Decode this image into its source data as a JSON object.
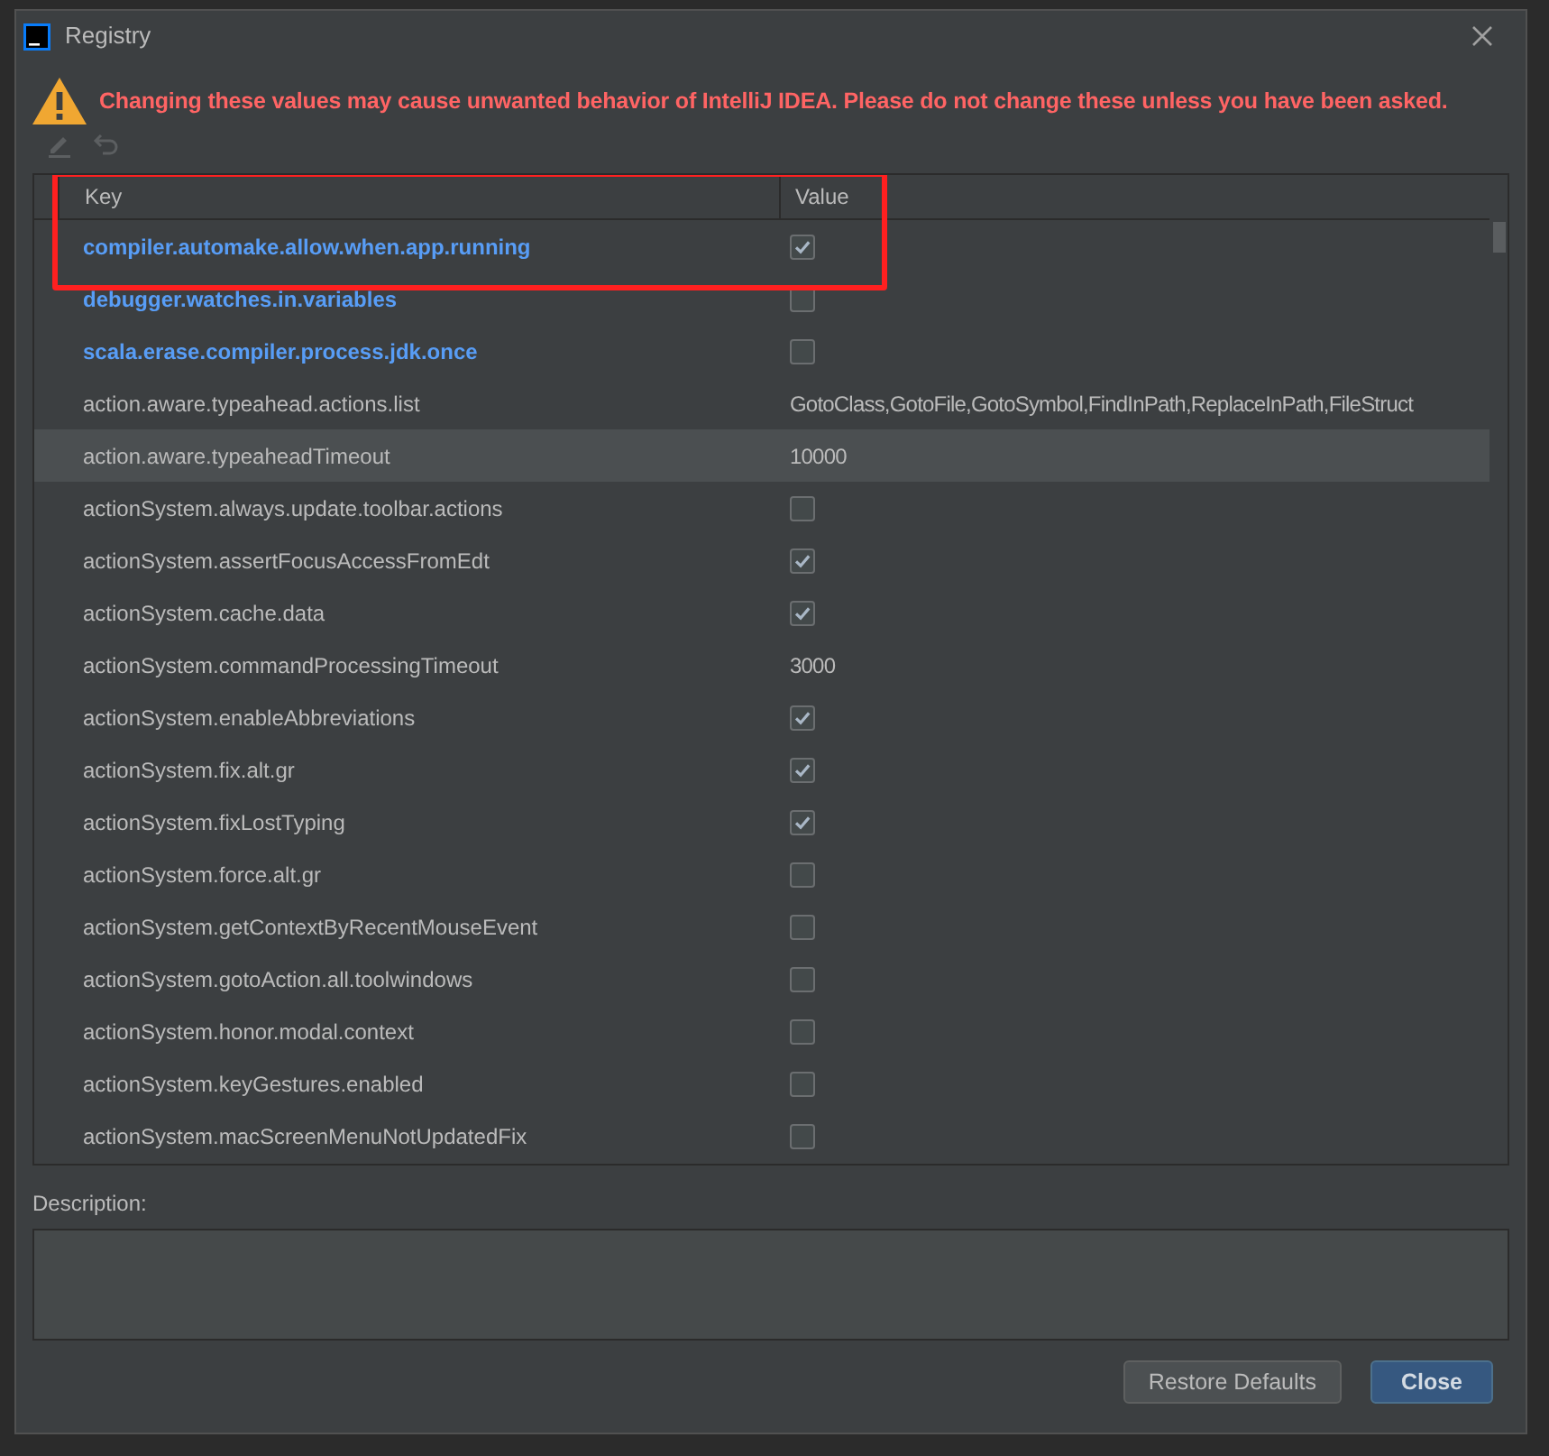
{
  "window": {
    "title": "Registry"
  },
  "warning": "Changing these values may cause unwanted behavior of IntelliJ IDEA. Please do not change these unless you have been asked.",
  "toolbar": [
    {
      "kind": "edit",
      "disabled": true
    },
    {
      "kind": "undo",
      "disabled": true
    }
  ],
  "table": {
    "columns": [
      "Key",
      "Value"
    ],
    "rows": [
      {
        "key": "compiler.automake.allow.when.app.running",
        "kind": "bool",
        "checked": true,
        "modified": true,
        "selected": false
      },
      {
        "key": "debugger.watches.in.variables",
        "kind": "bool",
        "checked": false,
        "modified": true,
        "selected": false
      },
      {
        "key": "scala.erase.compiler.process.jdk.once",
        "kind": "bool",
        "checked": false,
        "modified": true,
        "selected": false
      },
      {
        "key": "action.aware.typeahead.actions.list",
        "kind": "text",
        "value": "GotoClass,GotoFile,GotoSymbol,FindInPath,ReplaceInPath,FileStruct",
        "modified": false,
        "selected": false
      },
      {
        "key": "action.aware.typeaheadTimeout",
        "kind": "text",
        "value": "10000",
        "modified": false,
        "selected": true
      },
      {
        "key": "actionSystem.always.update.toolbar.actions",
        "kind": "bool",
        "checked": false,
        "modified": false,
        "selected": false
      },
      {
        "key": "actionSystem.assertFocusAccessFromEdt",
        "kind": "bool",
        "checked": true,
        "modified": false,
        "selected": false
      },
      {
        "key": "actionSystem.cache.data",
        "kind": "bool",
        "checked": true,
        "modified": false,
        "selected": false
      },
      {
        "key": "actionSystem.commandProcessingTimeout",
        "kind": "text",
        "value": "3000",
        "modified": false,
        "selected": false
      },
      {
        "key": "actionSystem.enableAbbreviations",
        "kind": "bool",
        "checked": true,
        "modified": false,
        "selected": false
      },
      {
        "key": "actionSystem.fix.alt.gr",
        "kind": "bool",
        "checked": true,
        "modified": false,
        "selected": false
      },
      {
        "key": "actionSystem.fixLostTyping",
        "kind": "bool",
        "checked": true,
        "modified": false,
        "selected": false
      },
      {
        "key": "actionSystem.force.alt.gr",
        "kind": "bool",
        "checked": false,
        "modified": false,
        "selected": false
      },
      {
        "key": "actionSystem.getContextByRecentMouseEvent",
        "kind": "bool",
        "checked": false,
        "modified": false,
        "selected": false
      },
      {
        "key": "actionSystem.gotoAction.all.toolwindows",
        "kind": "bool",
        "checked": false,
        "modified": false,
        "selected": false
      },
      {
        "key": "actionSystem.honor.modal.context",
        "kind": "bool",
        "checked": false,
        "modified": false,
        "selected": false
      },
      {
        "key": "actionSystem.keyGestures.enabled",
        "kind": "bool",
        "checked": false,
        "modified": false,
        "selected": false
      },
      {
        "key": "actionSystem.macScreenMenuNotUpdatedFix",
        "kind": "bool",
        "checked": false,
        "modified": false,
        "selected": false
      }
    ]
  },
  "annotation": {
    "kind": "frame"
  },
  "description": {
    "label": "Description:"
  },
  "buttons": [
    {
      "label": "Restore Defaults",
      "kind": "secondary"
    },
    {
      "label": "Close",
      "kind": "primary"
    }
  ]
}
